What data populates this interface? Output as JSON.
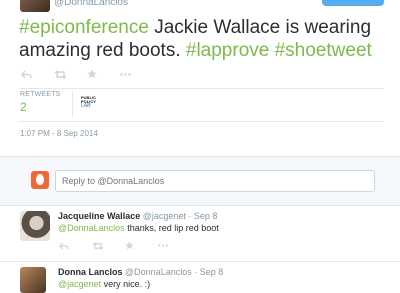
{
  "original_tweet": {
    "author_handle": "@DonnaLanclos",
    "text_parts": {
      "hashtag1": "#epiconference",
      "body": " Jackie Wallace is wearing amazing red boots. ",
      "hashtag2": "#lapprove",
      "hashtag3": "#shoetweet"
    },
    "retweets_label": "RETWEETS",
    "retweets_count": "2",
    "retweeter_name": "PUBLIC POLICY",
    "retweeter_lab": "LAB",
    "timestamp": "1:07 PM - 8 Sep 2014"
  },
  "reply_box": {
    "placeholder": "Reply to @DonnaLanclos"
  },
  "replies": [
    {
      "name": "Jacqueline Wallace",
      "handle": "@jacgenet",
      "date": "· Sep 8",
      "mention": "@DonnaLanclos",
      "text": " thanks, red lip red boot"
    },
    {
      "name": "Donna Lanclos",
      "handle": "@DonnaLanclos",
      "date": "· Sep 8",
      "mention": "@jacgenet",
      "text": " very nice. :)"
    }
  ],
  "icons": {
    "reply": "reply-icon",
    "retweet": "retweet-icon",
    "favorite": "star-icon",
    "more": "more-icon"
  },
  "colors": {
    "accent_green": "#7fb94e",
    "follow_blue": "#55acee",
    "muted": "#8899a6"
  }
}
